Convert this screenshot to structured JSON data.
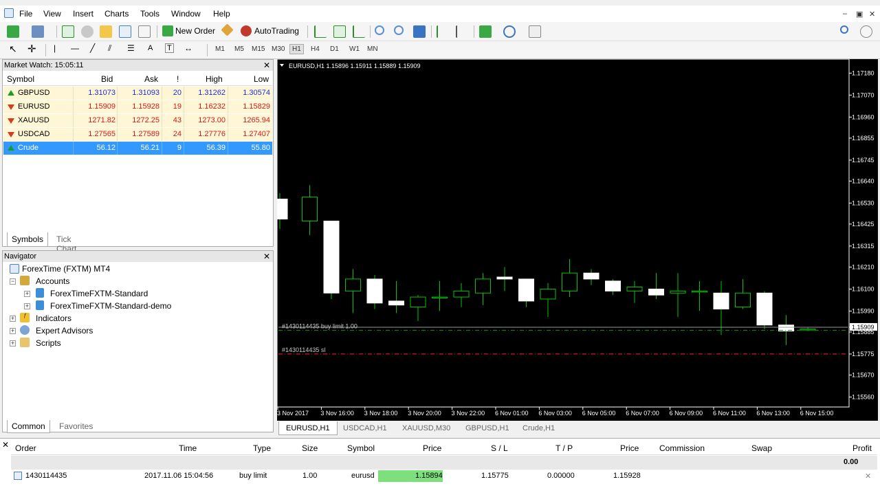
{
  "menu": [
    "File",
    "View",
    "Insert",
    "Charts",
    "Tools",
    "Window",
    "Help"
  ],
  "toolbar": {
    "new_order": "New Order",
    "auto_trading": "AutoTrading"
  },
  "timeframes": [
    "M1",
    "M5",
    "M15",
    "M30",
    "H1",
    "H4",
    "D1",
    "W1",
    "MN"
  ],
  "active_timeframe": "H1",
  "market_watch": {
    "title": "Market Watch: 15:05:11",
    "columns": [
      "Symbol",
      "Bid",
      "Ask",
      "!",
      "High",
      "Low"
    ],
    "rows": [
      {
        "symbol": "GBPUSD",
        "bid": "1.31073",
        "ask": "1.31093",
        "spread": "20",
        "high": "1.31262",
        "low": "1.30574",
        "dir": "up"
      },
      {
        "symbol": "EURUSD",
        "bid": "1.15909",
        "ask": "1.15928",
        "spread": "19",
        "high": "1.16232",
        "low": "1.15829",
        "dir": "down"
      },
      {
        "symbol": "XAUUSD",
        "bid": "1271.82",
        "ask": "1272.25",
        "spread": "43",
        "high": "1273.00",
        "low": "1265.94",
        "dir": "down"
      },
      {
        "symbol": "USDCAD",
        "bid": "1.27565",
        "ask": "1.27589",
        "spread": "24",
        "high": "1.27776",
        "low": "1.27407",
        "dir": "down"
      },
      {
        "symbol": "Crude",
        "bid": "56.12",
        "ask": "56.21",
        "spread": "9",
        "high": "56.39",
        "low": "55.80",
        "dir": "up"
      }
    ],
    "tabs": [
      "Symbols",
      "Tick Chart"
    ]
  },
  "navigator": {
    "title": "Navigator",
    "root": "ForexTime (FXTM) MT4",
    "accounts": "Accounts",
    "account_items": [
      "ForexTimeFXTM-Standard",
      "ForexTimeFXTM-Standard-demo"
    ],
    "indicators": "Indicators",
    "experts": "Expert Advisors",
    "scripts": "Scripts",
    "tabs": [
      "Common",
      "Favorites"
    ]
  },
  "chart": {
    "header": "EURUSD,H1  1.15896 1.15911 1.15889 1.15909",
    "price_labels": [
      "1.17180",
      "1.17070",
      "1.16960",
      "1.16855",
      "1.16745",
      "1.16640",
      "1.16530",
      "1.16425",
      "1.16315",
      "1.16210",
      "1.16100",
      "1.15990",
      "1.15909",
      "1.15885",
      "1.15775",
      "1.15670",
      "1.15560"
    ],
    "time_labels": [
      "3 Nov 2017",
      "3 Nov 16:00",
      "3 Nov 18:00",
      "3 Nov 20:00",
      "3 Nov 22:00",
      "6 Nov 01:00",
      "6 Nov 03:00",
      "6 Nov 05:00",
      "6 Nov 07:00",
      "6 Nov 09:00",
      "6 Nov 11:00",
      "6 Nov 13:00",
      "6 Nov 15:00"
    ],
    "buy_limit_label": "#1430114435 buy limit 1.00",
    "sl_label": "#1430114435 sl",
    "current_price": "1.15909",
    "colors": {
      "bull": "#ffffff",
      "wick": "#00c800",
      "sl": "#ff2020",
      "order": "#00a000"
    }
  },
  "chart_data": {
    "type": "candlestick",
    "ylim": [
      1.1551,
      1.1725
    ],
    "candles": [
      {
        "o": 1.1655,
        "h": 1.1658,
        "l": 1.164,
        "c": 1.1645
      },
      {
        "o": 1.1644,
        "h": 1.1662,
        "l": 1.1637,
        "c": 1.1656
      },
      {
        "o": 1.1644,
        "h": 1.1644,
        "l": 1.1605,
        "c": 1.1608
      },
      {
        "o": 1.1609,
        "h": 1.162,
        "l": 1.1598,
        "c": 1.1615
      },
      {
        "o": 1.1615,
        "h": 1.1617,
        "l": 1.16,
        "c": 1.1603
      },
      {
        "o": 1.1604,
        "h": 1.1614,
        "l": 1.1598,
        "c": 1.1602
      },
      {
        "o": 1.1601,
        "h": 1.1607,
        "l": 1.1594,
        "c": 1.1606
      },
      {
        "o": 1.1606,
        "h": 1.1614,
        "l": 1.1599,
        "c": 1.1606
      },
      {
        "o": 1.1606,
        "h": 1.1613,
        "l": 1.1601,
        "c": 1.1609
      },
      {
        "o": 1.1608,
        "h": 1.1618,
        "l": 1.1602,
        "c": 1.1615
      },
      {
        "o": 1.1616,
        "h": 1.1621,
        "l": 1.1609,
        "c": 1.1615
      },
      {
        "o": 1.1615,
        "h": 1.1615,
        "l": 1.1601,
        "c": 1.1604
      },
      {
        "o": 1.1605,
        "h": 1.1613,
        "l": 1.1596,
        "c": 1.161
      },
      {
        "o": 1.1609,
        "h": 1.1625,
        "l": 1.1606,
        "c": 1.1618
      },
      {
        "o": 1.1618,
        "h": 1.162,
        "l": 1.1612,
        "c": 1.1615
      },
      {
        "o": 1.1614,
        "h": 1.1615,
        "l": 1.1607,
        "c": 1.1609
      },
      {
        "o": 1.1609,
        "h": 1.1614,
        "l": 1.1603,
        "c": 1.1611
      },
      {
        "o": 1.161,
        "h": 1.1618,
        "l": 1.1605,
        "c": 1.1607
      },
      {
        "o": 1.1608,
        "h": 1.1618,
        "l": 1.1596,
        "c": 1.1609
      },
      {
        "o": 1.1609,
        "h": 1.1614,
        "l": 1.1599,
        "c": 1.1609
      },
      {
        "o": 1.1608,
        "h": 1.1614,
        "l": 1.1587,
        "c": 1.16
      },
      {
        "o": 1.1601,
        "h": 1.1615,
        "l": 1.16,
        "c": 1.1608
      },
      {
        "o": 1.1608,
        "h": 1.1609,
        "l": 1.159,
        "c": 1.1592
      },
      {
        "o": 1.1592,
        "h": 1.1597,
        "l": 1.1582,
        "c": 1.1589
      },
      {
        "o": 1.159,
        "h": 1.1591,
        "l": 1.1589,
        "c": 1.159
      }
    ],
    "buy_limit": 1.15894,
    "stop_loss": 1.15775,
    "bid": 1.15909
  },
  "chart_tabs": [
    "EURUSD,H1",
    "USDCAD,H1",
    "XAUUSD,M30",
    "GBPUSD,H1",
    "Crude,H1"
  ],
  "terminal": {
    "columns": [
      "Order",
      "Time",
      "Type",
      "Size",
      "Symbol",
      "Price",
      "S / L",
      "T / P",
      "Price",
      "Commission",
      "Swap",
      "Profit"
    ],
    "balance": "0.00",
    "order": {
      "order": "1430114435",
      "time": "2017.11.06 15:04:56",
      "type": "buy limit",
      "size": "1.00",
      "symbol": "eurusd",
      "price": "1.15894",
      "sl": "1.15775",
      "tp": "0.00000",
      "cur_price": "1.15928"
    }
  }
}
